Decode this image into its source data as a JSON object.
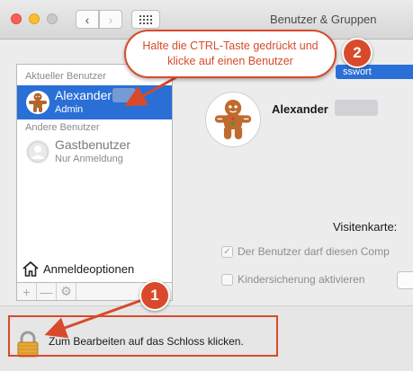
{
  "window": {
    "title": "Benutzer & Gruppen"
  },
  "sidebar": {
    "current_section": "Aktueller Benutzer",
    "current_user": {
      "name": "Alexander",
      "role": "Admin"
    },
    "other_section": "Andere Benutzer",
    "guest_user": {
      "name": "Gastbenutzer",
      "role": "Nur Anmeldung"
    },
    "login_options": "Anmeldeoptionen",
    "toolbar": {
      "add": "+",
      "remove": "—",
      "settings": "⚙"
    }
  },
  "main": {
    "tab_stub": "sswort",
    "user_name": "Alexander",
    "card_label": "Visitenkarte:",
    "check_admin": "Der Benutzer darf diesen Comp",
    "check_parental": "Kindersicherung aktivieren"
  },
  "bottom": {
    "lock_text": "Zum Bearbeiten auf das Schloss klicken."
  },
  "annotations": {
    "callout_line1": "Halte die CTRL-Taste gedrückt und",
    "callout_line2": "klicke auf einen Benutzer",
    "badge_1": "1",
    "badge_2": "2"
  },
  "colors": {
    "annotation": "#d84a2b",
    "selection": "#2a6fd6"
  },
  "icons": [
    "back-icon",
    "forward-icon",
    "grid-icon",
    "gingerbread-avatar-icon",
    "guest-avatar-icon",
    "house-icon",
    "gear-icon",
    "lock-icon",
    "checkmark-icon"
  ]
}
